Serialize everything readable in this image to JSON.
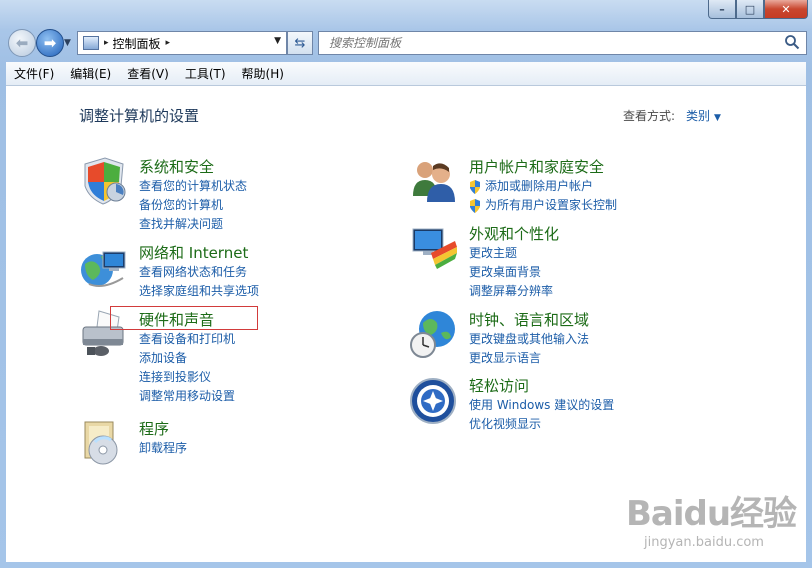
{
  "window": {
    "caption_buttons": [
      "–",
      "□",
      "✕"
    ]
  },
  "address_bar": {
    "path": "控制面板",
    "separator": "▸"
  },
  "search": {
    "placeholder": "搜索控制面板"
  },
  "menu": [
    "文件(F)",
    "编辑(E)",
    "查看(V)",
    "工具(T)",
    "帮助(H)"
  ],
  "page": {
    "title": "调整计算机的设置",
    "view_by_label": "查看方式:",
    "view_by_value": "类别"
  },
  "categories_left": [
    {
      "title": "系统和安全",
      "links": [
        "查看您的计算机状态",
        "备份您的计算机",
        "查找并解决问题"
      ],
      "icon": "shield-icon"
    },
    {
      "title": "网络和 Internet",
      "links": [
        "查看网络状态和任务",
        "选择家庭组和共享选项"
      ],
      "icon": "network-icon"
    },
    {
      "title": "硬件和声音",
      "links": [
        "查看设备和打印机",
        "添加设备",
        "连接到投影仪",
        "调整常用移动设置"
      ],
      "icon": "printer-icon"
    },
    {
      "title": "程序",
      "links": [
        "卸载程序"
      ],
      "icon": "programs-icon"
    }
  ],
  "categories_right": [
    {
      "title": "用户帐户和家庭安全",
      "links": [
        "添加或删除用户帐户",
        "为所有用户设置家长控制"
      ],
      "icon": "users-icon"
    },
    {
      "title": "外观和个性化",
      "links": [
        "更改主题",
        "更改桌面背景",
        "调整屏幕分辨率"
      ],
      "icon": "appearance-icon"
    },
    {
      "title": "时钟、语言和区域",
      "links": [
        "更改键盘或其他输入法",
        "更改显示语言"
      ],
      "icon": "clock-globe-icon"
    },
    {
      "title": "轻松访问",
      "links": [
        "使用 Windows 建议的设置",
        "优化视频显示"
      ],
      "icon": "ease-of-access-icon"
    }
  ],
  "watermark": {
    "main": "Baidu经验",
    "sub": "jingyan.baidu.com"
  }
}
